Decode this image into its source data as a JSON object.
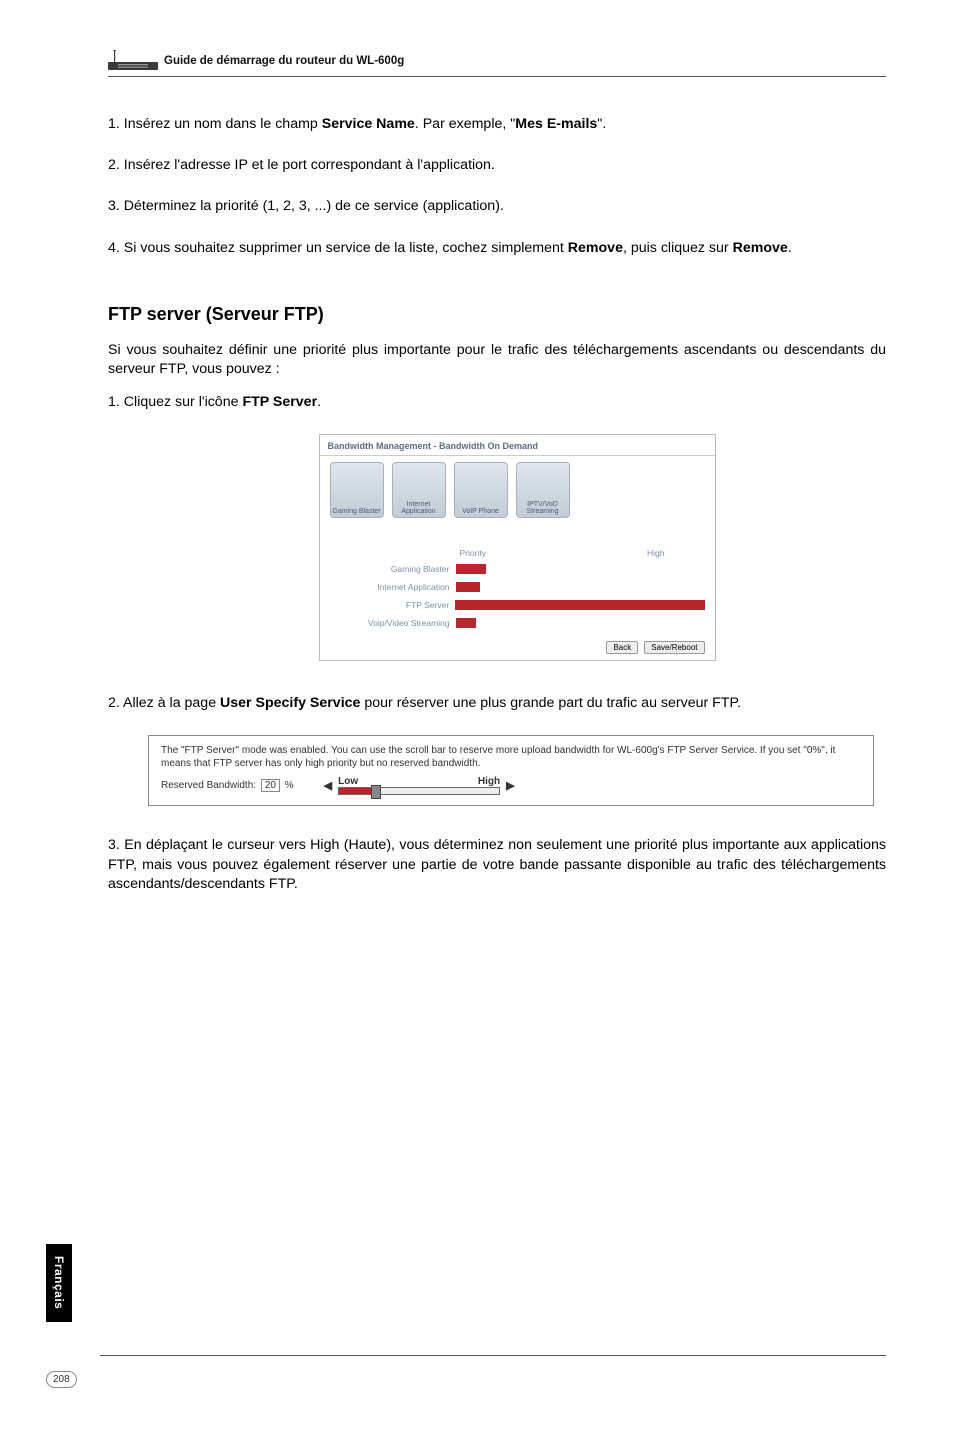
{
  "header": {
    "guide_title": "Guide de démarrage du routeur du WL-600g"
  },
  "steps_top": [
    {
      "n": "1.",
      "pre": "Insérez un nom dans le champ ",
      "b1": "Service Name",
      "mid": ". Par exemple, \"",
      "b2": "Mes E-mails",
      "post": "\"."
    },
    {
      "n": "2.",
      "text": "Insérez l'adresse IP et le port correspondant à l'application."
    },
    {
      "n": "3.",
      "text": "Déterminez la priorité (1, 2, 3, ...) de ce service (application)."
    },
    {
      "n": "4.",
      "pre": "Si vous souhaitez supprimer un service de la liste, cochez simplement ",
      "b1": "Remove",
      "mid": ", puis cliquez sur ",
      "b2": "Remove",
      "post": "."
    }
  ],
  "section": {
    "heading": "FTP server (Serveur FTP)",
    "intro": "Si vous souhaitez définir une priorité plus importante pour le trafic des téléchargements ascendants ou descendants du serveur FTP, vous pouvez :"
  },
  "step1": {
    "n": "1.",
    "pre": "Cliquez sur l'icône ",
    "b": "FTP Server",
    "post": "."
  },
  "fig1": {
    "title": "Bandwidth Management - Bandwidth On Demand",
    "icons": [
      "Gaming Blaster",
      "Internet Application",
      "VoIP Phone",
      "IPTV/VoD Streaming"
    ],
    "col_priority": "Priority",
    "col_high": "High",
    "rows": [
      "Gaming Blaster",
      "Internet Application",
      "FTP Server",
      "Voip/Video Streaming"
    ],
    "btn_back": "Back",
    "btn_save": "Save/Reboot"
  },
  "step2": {
    "n": "2.",
    "pre": "Allez à la page ",
    "b": "User Specify Service",
    "post": " pour réserver une plus grande part du trafic au serveur FTP."
  },
  "fig2": {
    "desc": "The \"FTP Server\" mode was enabled. You can use the scroll bar to reserve more upload bandwidth for WL-600g's FTP Server Service. If you set \"0%\", it means that FTP server has only high priority but no reserved bandwidth.",
    "reserved_label": "Reserved Bandwidth:",
    "reserved_value": "20",
    "reserved_pct": "%",
    "low": "Low",
    "high": "High"
  },
  "step3": {
    "n": "3.",
    "text": "En déplaçant le curseur vers High (Haute), vous déterminez non seulement une priorité plus importante aux applications FTP, mais vous pouvez également réserver une partie de votre bande passante disponible au trafic des téléchargements ascendants/descendants FTP."
  },
  "side": {
    "lang": "Français"
  },
  "page": {
    "num": "208"
  }
}
